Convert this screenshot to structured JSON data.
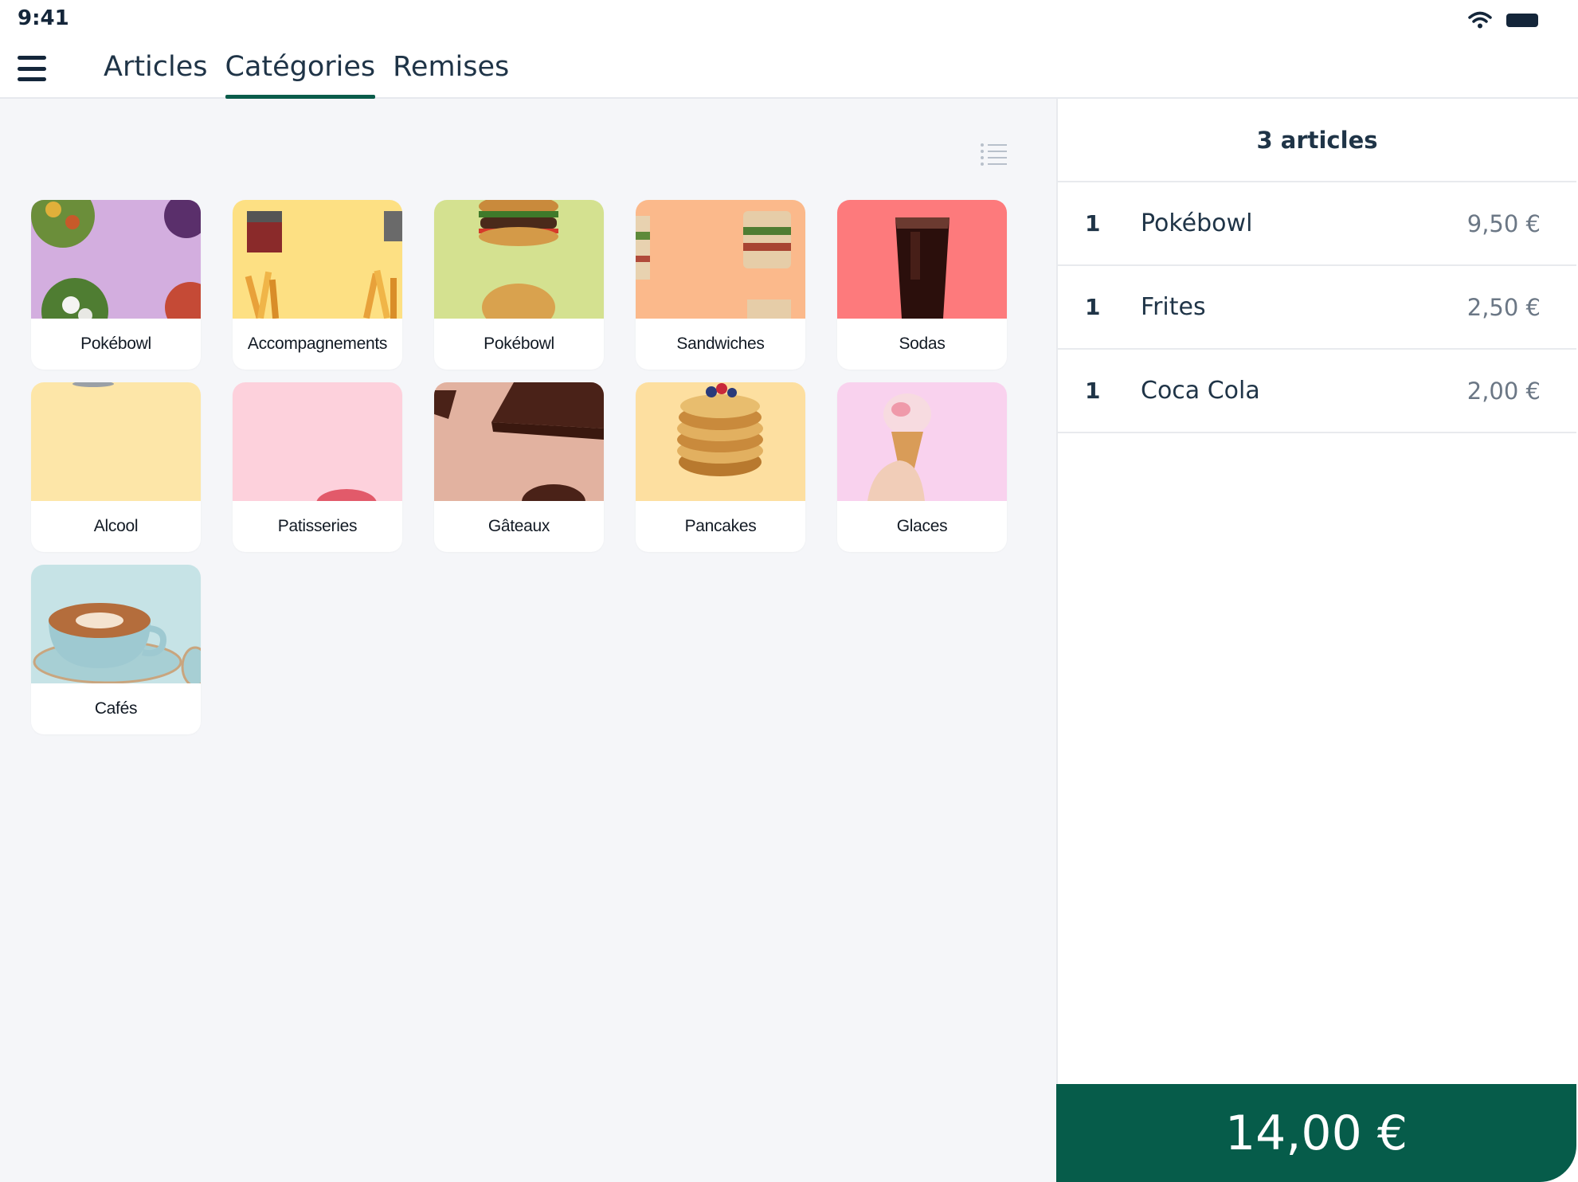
{
  "status_bar": {
    "time": "9:41"
  },
  "tabs": [
    {
      "label": "Articles",
      "active": false
    },
    {
      "label": "Catégories",
      "active": true
    },
    {
      "label": "Remises",
      "active": false
    }
  ],
  "categories": [
    {
      "label": "Pokébowl",
      "color": "#d3aedf"
    },
    {
      "label": "Accompagnements",
      "color": "#fde083"
    },
    {
      "label": "Pokébowl",
      "color": "#d4e190"
    },
    {
      "label": "Sandwiches",
      "color": "#fbb98b"
    },
    {
      "label": "Sodas",
      "color": "#fd7a7c"
    },
    {
      "label": "Alcool",
      "color": "#fde6a8"
    },
    {
      "label": "Patisseries",
      "color": "#fdd1dc"
    },
    {
      "label": "Gâteaux",
      "color": "#e2b2a0"
    },
    {
      "label": "Pancakes",
      "color": "#fddfa0"
    },
    {
      "label": "Glaces",
      "color": "#f9d2ee"
    },
    {
      "label": "Cafés",
      "color": "#c6e3e6"
    }
  ],
  "order": {
    "title": "3 articles",
    "items": [
      {
        "qty": "1",
        "name": "Pokébowl",
        "price": "9,50 €"
      },
      {
        "qty": "1",
        "name": "Frites",
        "price": "2,50 €"
      },
      {
        "qty": "1",
        "name": "Coca Cola",
        "price": "2,00 €"
      }
    ],
    "total": "14,00 €"
  },
  "colors": {
    "accent": "#065c4a",
    "text": "#1f3447",
    "background": "#f5f6f9"
  }
}
